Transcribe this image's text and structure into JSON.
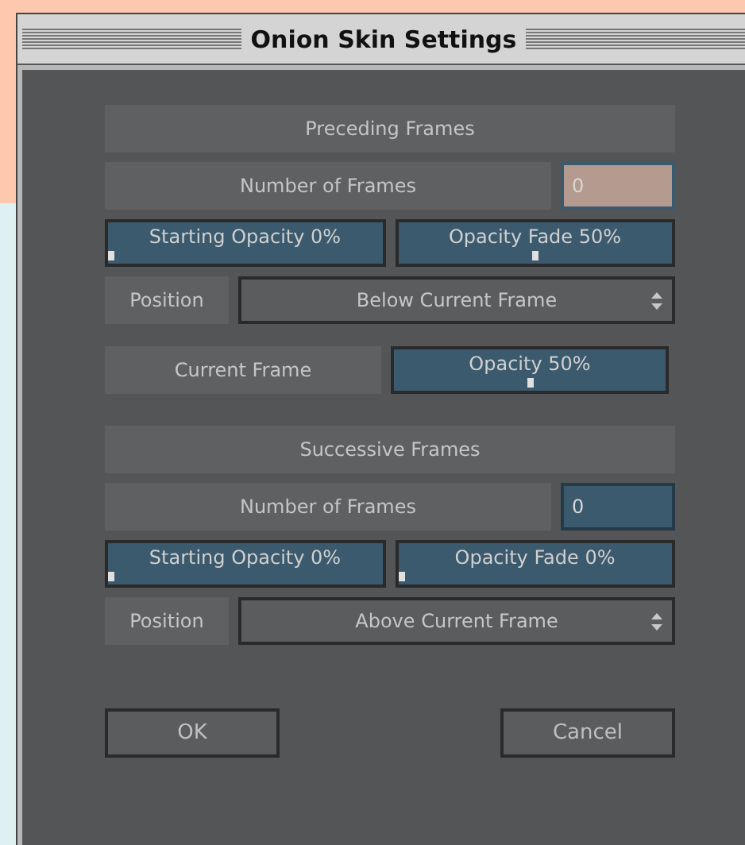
{
  "window": {
    "title": "Onion Skin Settings"
  },
  "preceding": {
    "header": "Preceding Frames",
    "number_label": "Number of Frames",
    "number_value": "0",
    "focused": true,
    "sliders": [
      {
        "label": "Starting Opacity 0%",
        "level": 0
      },
      {
        "label": "Opacity Fade 50%",
        "level": 0.5
      }
    ],
    "position_label": "Position",
    "position_value": "Below Current Frame"
  },
  "current": {
    "label": "Current Frame",
    "slider": {
      "label": "Opacity 50%",
      "level": 0.5
    }
  },
  "successive": {
    "header": "Successive Frames",
    "number_label": "Number of Frames",
    "number_value": "0",
    "focused": false,
    "sliders": [
      {
        "label": "Starting Opacity 0%",
        "level": 0
      },
      {
        "label": "Opacity Fade 0%",
        "level": 0
      }
    ],
    "position_label": "Position",
    "position_value": "Above Current Frame"
  },
  "buttons": [
    "OK",
    "Cancel"
  ]
}
